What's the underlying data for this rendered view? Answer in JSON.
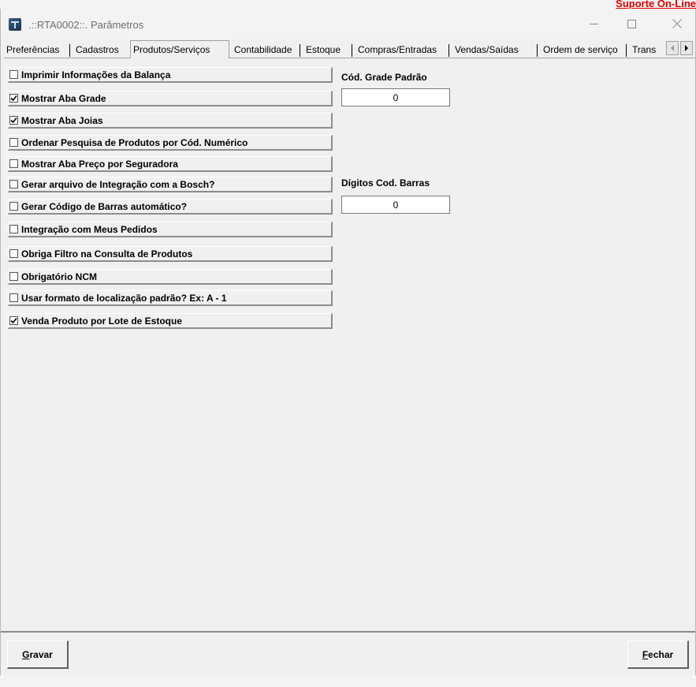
{
  "support_link": "Suporte On-Line",
  "window": {
    "title": ".::RTA0002::. Parâmetros"
  },
  "tabs": [
    "Preferências",
    "Cadastros",
    "Produtos/Serviços",
    "Contabilidade",
    "Estoque",
    "Compras/Entradas",
    "Vendas/Saídas",
    "Ordem de serviço",
    "Trans"
  ],
  "active_tab": "Produtos/Serviços",
  "options": [
    {
      "label": "Imprimir Informações da Balança",
      "checked": false
    },
    {
      "label": "Mostrar Aba Grade",
      "checked": true
    },
    {
      "label": "Mostrar Aba Joias",
      "checked": true
    },
    {
      "label": "Ordenar Pesquisa de Produtos por Cód. Numérico",
      "checked": false
    },
    {
      "label": "Mostrar Aba Preço por Seguradora",
      "checked": false
    },
    {
      "label": "Gerar arquivo de Integração com a Bosch?",
      "checked": false
    },
    {
      "label": "Gerar Código de Barras automático?",
      "checked": false
    },
    {
      "label": "Integração com Meus Pedidos",
      "checked": false
    },
    {
      "label": "Obriga Filtro na Consulta de Produtos",
      "checked": false
    },
    {
      "label": "Obrigatório NCM",
      "checked": false
    },
    {
      "label": "Usar formato de localização padrão? Ex: A - 1",
      "checked": false
    },
    {
      "label": "Venda Produto por Lote de Estoque",
      "checked": true
    }
  ],
  "fields": {
    "grade": {
      "label": "Cód. Grade Padrão",
      "value": "0"
    },
    "barcode_digits": {
      "label": "Dígitos Cod. Barras",
      "value": "0"
    }
  },
  "buttons": {
    "save": {
      "mnemonic": "G",
      "rest": "ravar"
    },
    "close": {
      "mnemonic": "F",
      "rest": "echar"
    }
  },
  "icons": {
    "app": "app-logo-icon",
    "minimize": "minimize-icon",
    "maximize": "maximize-icon",
    "close": "close-icon",
    "tab_left": "chevron-left-icon",
    "tab_right": "chevron-right-icon",
    "check": "checkmark-icon"
  }
}
